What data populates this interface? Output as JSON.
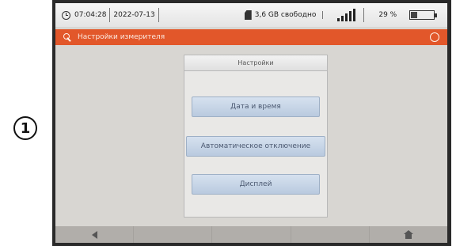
{
  "callout": {
    "number": "1"
  },
  "statusbar": {
    "time": "07:04:28",
    "date": "2022-07-13",
    "memory": "3,6 GB свободно",
    "battery_percent": "29 %",
    "battery_level": 0.29,
    "signal_bars": 5
  },
  "titlebar": {
    "title": "Настройки измерителя"
  },
  "panel": {
    "header": "Настройки",
    "buttons": [
      "Дата и время",
      "Автоматическое отключение",
      "Дисплей"
    ]
  },
  "icons": {
    "clock": "clock-icon",
    "memory": "sd-card-icon",
    "signal": "signal-icon",
    "battery": "battery-icon",
    "title": "key-icon",
    "info": "info-icon",
    "back": "back-arrow-icon",
    "home": "home-icon"
  },
  "colors": {
    "titlebar": "#e2572a",
    "button": "#c8d6e8",
    "background": "#d8d6d2",
    "bottombar": "#b1aeaa"
  }
}
